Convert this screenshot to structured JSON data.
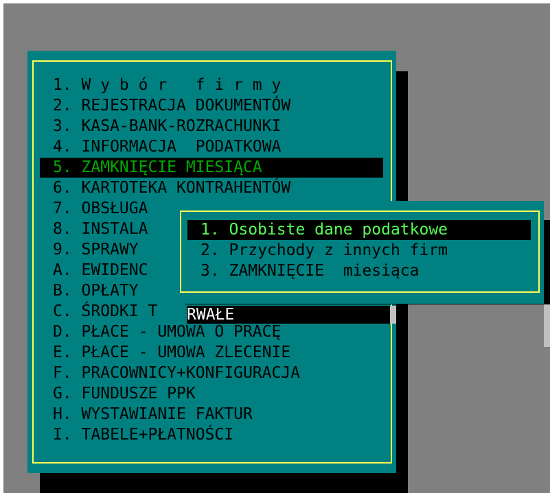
{
  "colors": {
    "background": "#808080",
    "panel": "#008080",
    "frame": "#ffff55",
    "text": "#000000",
    "selected_main_text": "#00aa00",
    "selected_sub_text": "#55ff55",
    "selection_bg": "#000000"
  },
  "main_menu": {
    "items": [
      {
        "label": "1. W y b ó r   f i r m y"
      },
      {
        "label": "2. REJESTRACJA DOKUMENTÓW"
      },
      {
        "label": "3. KASA-BANK-ROZRACHUNKI"
      },
      {
        "label": "4. INFORMACJA  PODATKOWA"
      },
      {
        "label": "5. ZAMKNIĘCIE MIESIĄCA",
        "selected": true
      },
      {
        "label": "6. KARTOTEKA KONTRAHENTÓW"
      },
      {
        "label": "7. OBSŁUGA"
      },
      {
        "label": "8. INSTALA"
      },
      {
        "label": "9. SPRAWY"
      },
      {
        "label": "A. EWIDENC"
      },
      {
        "label": "B. OPŁATY"
      },
      {
        "label": "C. ŚRODKI T"
      },
      {
        "label": "D. PŁACE - UMOWA O PRACĘ"
      },
      {
        "label": "E. PŁACE - UMOWA ZLECENIE"
      },
      {
        "label": "F. PRACOWNICY+KONFIGURACJA"
      },
      {
        "label": "G. FUNDUSZE PPK"
      },
      {
        "label": "H. WYSTAWIANIE FAKTUR"
      },
      {
        "label": "I. TABELE+PŁATNOŚCI"
      }
    ]
  },
  "submenu": {
    "items": [
      {
        "label": "1. Osobiste dane podatkowe",
        "selected": true
      },
      {
        "label": "2. Przychody z innych firm"
      },
      {
        "label": "3. ZAMKNIĘCIE  miesiąca"
      }
    ]
  },
  "bleed_text": "RWAŁE"
}
